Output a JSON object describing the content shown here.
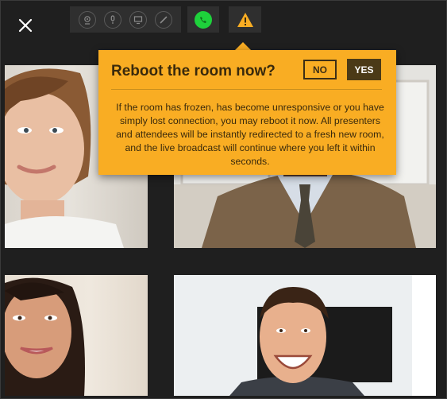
{
  "dialog": {
    "title": "Reboot the room now?",
    "no_label": "NO",
    "yes_label": "YES",
    "message": "If the room has frozen, has become unresponsive or you have simply lost connection, you may reboot it now. All presenters and attendees will be instantly redirected to a fresh new room, and the live broadcast will continue where you left it within seconds."
  },
  "colors": {
    "accent": "#f9ad23",
    "call_green": "#1ed13b",
    "background": "#1f1f1f"
  },
  "toolbar": {
    "icons": [
      "camera-icon",
      "microphone-icon",
      "screen-share-icon",
      "pen-icon",
      "phone-icon",
      "warning-icon"
    ]
  }
}
